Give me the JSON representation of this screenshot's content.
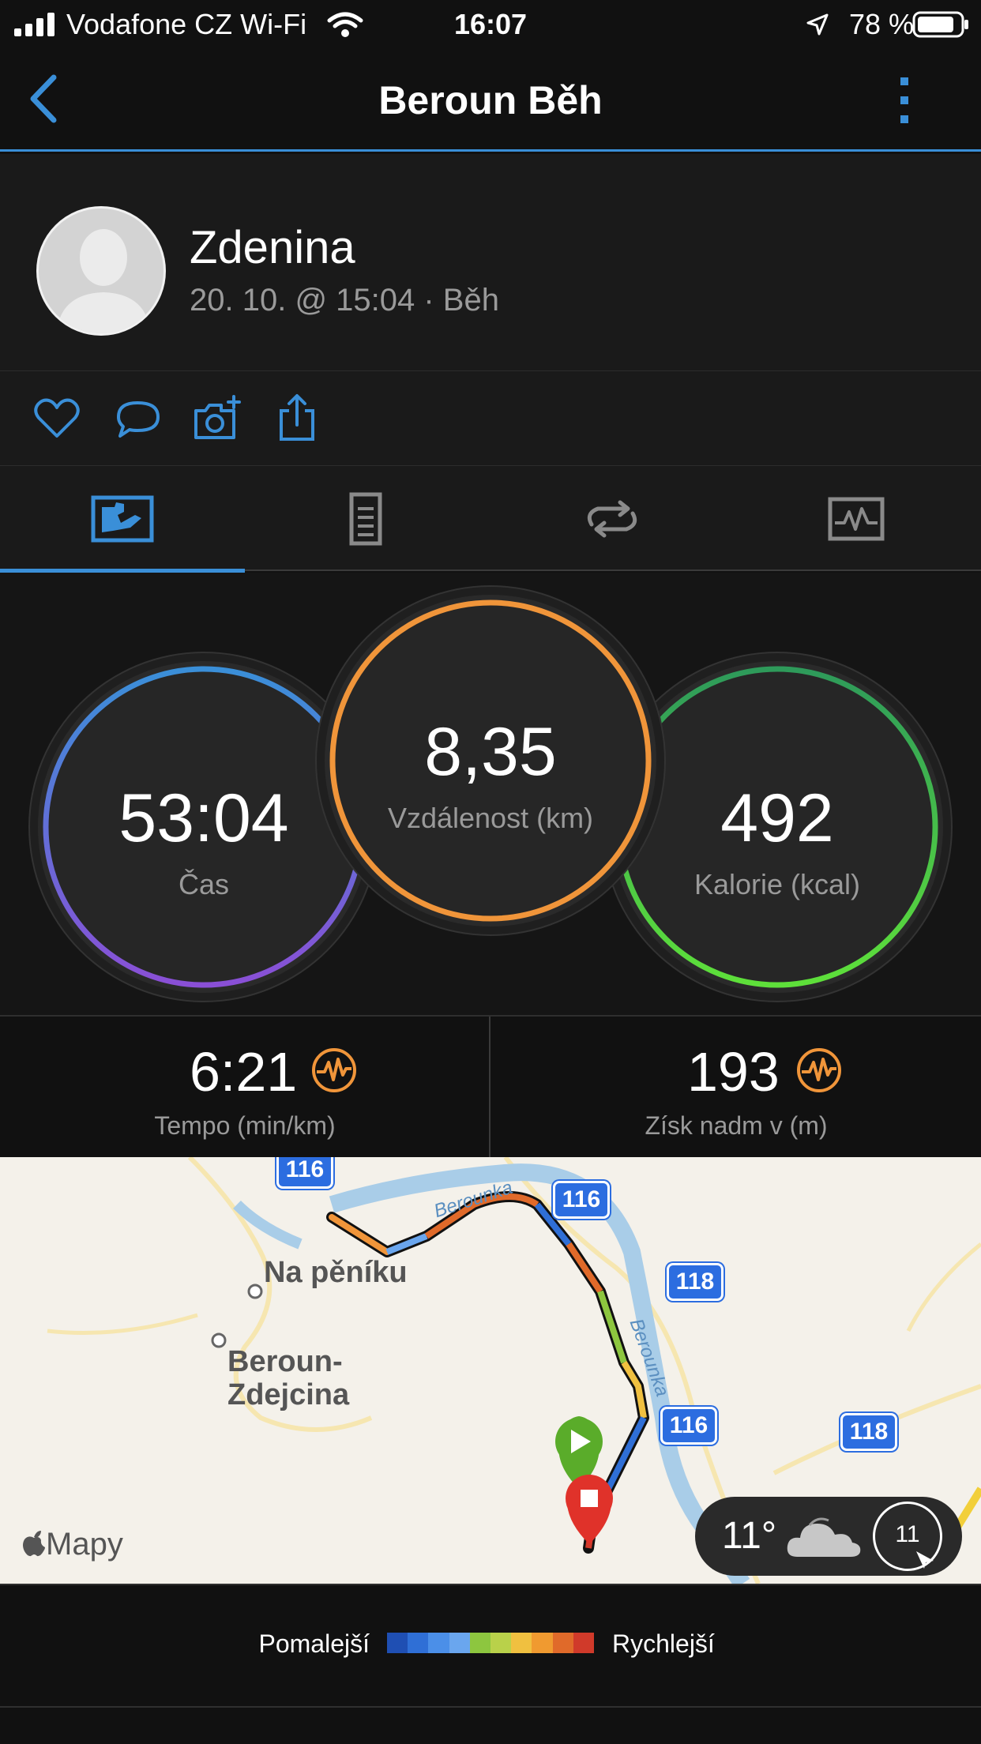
{
  "status_bar": {
    "carrier": "Vodafone CZ Wi-Fi",
    "time": "16:07",
    "battery": "78 %"
  },
  "header": {
    "title": "Beroun Běh",
    "back_icon": "chevron-left-icon",
    "more_icon": "vertical-dots-icon"
  },
  "profile": {
    "name": "Zdenina",
    "meta": "20. 10. @ 15:04 · Běh"
  },
  "actions": [
    {
      "icon": "heart-icon"
    },
    {
      "icon": "comment-icon"
    },
    {
      "icon": "camera-add-icon"
    },
    {
      "icon": "share-icon"
    }
  ],
  "tabs": [
    {
      "icon": "map-chart-icon",
      "active": true
    },
    {
      "icon": "document-list-icon",
      "active": false
    },
    {
      "icon": "laps-loop-icon",
      "active": false
    },
    {
      "icon": "activity-graph-icon",
      "active": false
    }
  ],
  "stats": {
    "time": {
      "value": "53:04",
      "label": "Čas"
    },
    "distance": {
      "value": "8,35",
      "label": "Vzdálenost (km)"
    },
    "calories": {
      "value": "492",
      "label": "Kalorie (kcal)"
    }
  },
  "metrics": {
    "pace": {
      "value": "6:21",
      "label": "Tempo (min/km)"
    },
    "elevation": {
      "value": "193",
      "label": "Získ nadm v (m)"
    }
  },
  "map": {
    "places": [
      "Na pěníku",
      "Beroun-",
      "Zdejcina"
    ],
    "rivers": [
      "Berounka",
      "Berounka"
    ],
    "roads": [
      "116",
      "116",
      "118",
      "116",
      "118"
    ],
    "credit": "Mapy",
    "weather_temp": "11°",
    "wind_speed": "11"
  },
  "legend": {
    "slow": "Pomalejší",
    "fast": "Rychlejší",
    "colors": [
      "#1f4fb3",
      "#2f6fd6",
      "#4b8fe8",
      "#6aa6ee",
      "#8dc63f",
      "#b9d14a",
      "#f0c040",
      "#f09a30",
      "#e06a2a",
      "#d03a2a"
    ]
  }
}
